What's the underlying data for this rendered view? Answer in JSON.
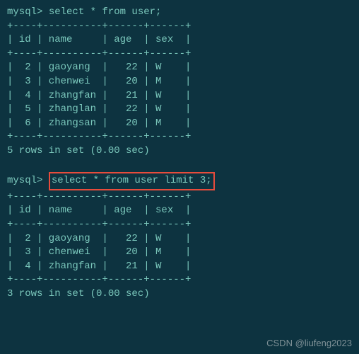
{
  "prompt": "mysql> ",
  "query1": {
    "sql": "select * from user;",
    "border_top": "+----+----------+------+------+",
    "header": "| id | name     | age  | sex  |",
    "border_mid": "+----+----------+------+------+",
    "rows": [
      "|  2 | gaoyang  |   22 | W    |",
      "|  3 | chenwei  |   20 | M    |",
      "|  4 | zhangfan |   21 | W    |",
      "|  5 | zhanglan |   22 | W    |",
      "|  6 | zhangsan |   20 | M    |"
    ],
    "border_bot": "+----+----------+------+------+",
    "status": "5 rows in set (0.00 sec)"
  },
  "query2": {
    "sql": "select * from user limit 3;",
    "border_top": "+----+----------+------+------+",
    "header": "| id | name     | age  | sex  |",
    "border_mid": "+----+----------+------+------+",
    "rows": [
      "|  2 | gaoyang  |   22 | W    |",
      "|  3 | chenwei  |   20 | M    |",
      "|  4 | zhangfan |   21 | W    |"
    ],
    "border_bot": "+----+----------+------+------+",
    "status": "3 rows in set (0.00 sec)"
  },
  "blank": " ",
  "watermark": "CSDN @liufeng2023"
}
